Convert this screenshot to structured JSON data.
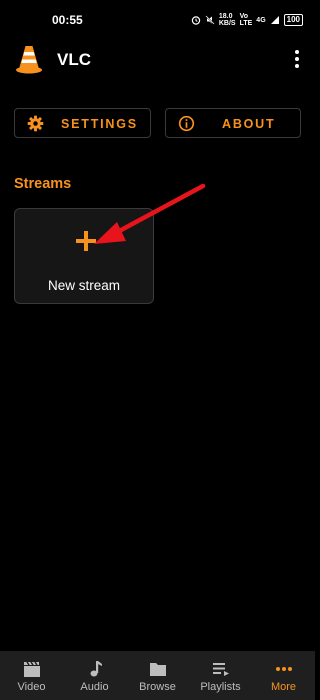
{
  "status_bar": {
    "time": "00:55",
    "speed_value": "18.0",
    "speed_unit": "KB/S",
    "volte_top": "Vo",
    "volte_bottom": "LTE",
    "signal": "4G",
    "battery": "100"
  },
  "app_bar": {
    "title": "VLC",
    "logo_icon": "vlc-cone-icon",
    "menu_icon": "overflow-menu-icon"
  },
  "buttons": {
    "settings_label": "SETTINGS",
    "settings_icon": "gear-icon",
    "about_label": "ABOUT",
    "about_icon": "info-icon"
  },
  "streams": {
    "title": "Streams",
    "new_stream_label": "New stream",
    "new_stream_icon": "plus-icon"
  },
  "bottom_nav": {
    "items": [
      {
        "label": "Video",
        "icon": "video-clapper-icon",
        "active": false
      },
      {
        "label": "Audio",
        "icon": "music-note-icon",
        "active": false
      },
      {
        "label": "Browse",
        "icon": "folder-icon",
        "active": false
      },
      {
        "label": "Playlists",
        "icon": "playlist-icon",
        "active": false
      },
      {
        "label": "More",
        "icon": "more-dots-icon",
        "active": true
      }
    ]
  },
  "colors": {
    "accent": "#f7921e",
    "background": "#000000",
    "nav_background": "#1f1f1f",
    "annotation_arrow": "#e8141b"
  }
}
